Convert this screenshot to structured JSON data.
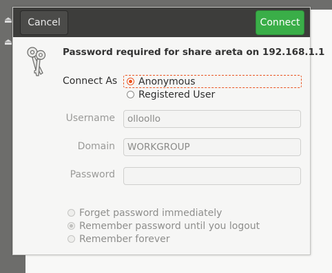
{
  "header": {
    "cancel_label": "Cancel",
    "connect_label": "Connect"
  },
  "dialog": {
    "title": "Password required for share  areta on 192.168.1.1",
    "connect_as_label": "Connect As",
    "connect_as_options": [
      {
        "label": "Anonymous",
        "selected": true
      },
      {
        "label": "Registered User",
        "selected": false
      }
    ],
    "fields": {
      "username": {
        "label": "Username",
        "value": "olloollo"
      },
      "domain": {
        "label": "Domain",
        "value": "WORKGROUP"
      },
      "password": {
        "label": "Password",
        "value": ""
      }
    },
    "remember_options": [
      {
        "label": "Forget password immediately",
        "selected": false
      },
      {
        "label": "Remember password until you logout",
        "selected": true
      },
      {
        "label": "Remember forever",
        "selected": false
      }
    ]
  },
  "icons": {
    "keys": "keys-icon",
    "eject": "eject-icon"
  },
  "colors": {
    "accent": "#e95420",
    "connect_button": "#3aae48",
    "headerbar": "#3d3d3b"
  }
}
